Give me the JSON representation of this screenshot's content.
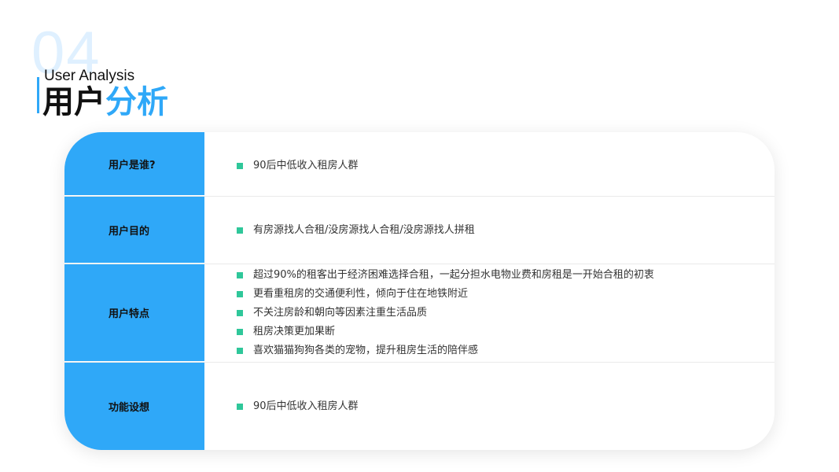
{
  "header": {
    "section_number": "04",
    "subtitle": "User Analysis",
    "title_part1": "用户",
    "title_part2": "分析"
  },
  "table": {
    "rows": [
      {
        "label": "用户是谁?",
        "items": [
          "90后中低收入租房人群"
        ]
      },
      {
        "label": "用户目的",
        "items": [
          "有房源找人合租/没房源找人合租/没房源找人拼租"
        ]
      },
      {
        "label": "用户特点",
        "items": [
          "超过90%的租客出于经济困难选择合租，一起分担水电物业费和房租是一开始合租的初衷",
          "更看重租房的交通便利性，倾向于住在地铁附近",
          "不关注房龄和朝向等因素注重生活品质",
          "租房决策更加果断",
          "喜欢猫猫狗狗各类的宠物，提升租房生活的陪伴感"
        ]
      },
      {
        "label": "功能设想",
        "items": [
          "90后中低收入租房人群"
        ]
      }
    ]
  },
  "colors": {
    "accent_blue": "#2fa8f8",
    "bullet_green": "#2fc79a",
    "number_watermark": "#dff0ff"
  }
}
